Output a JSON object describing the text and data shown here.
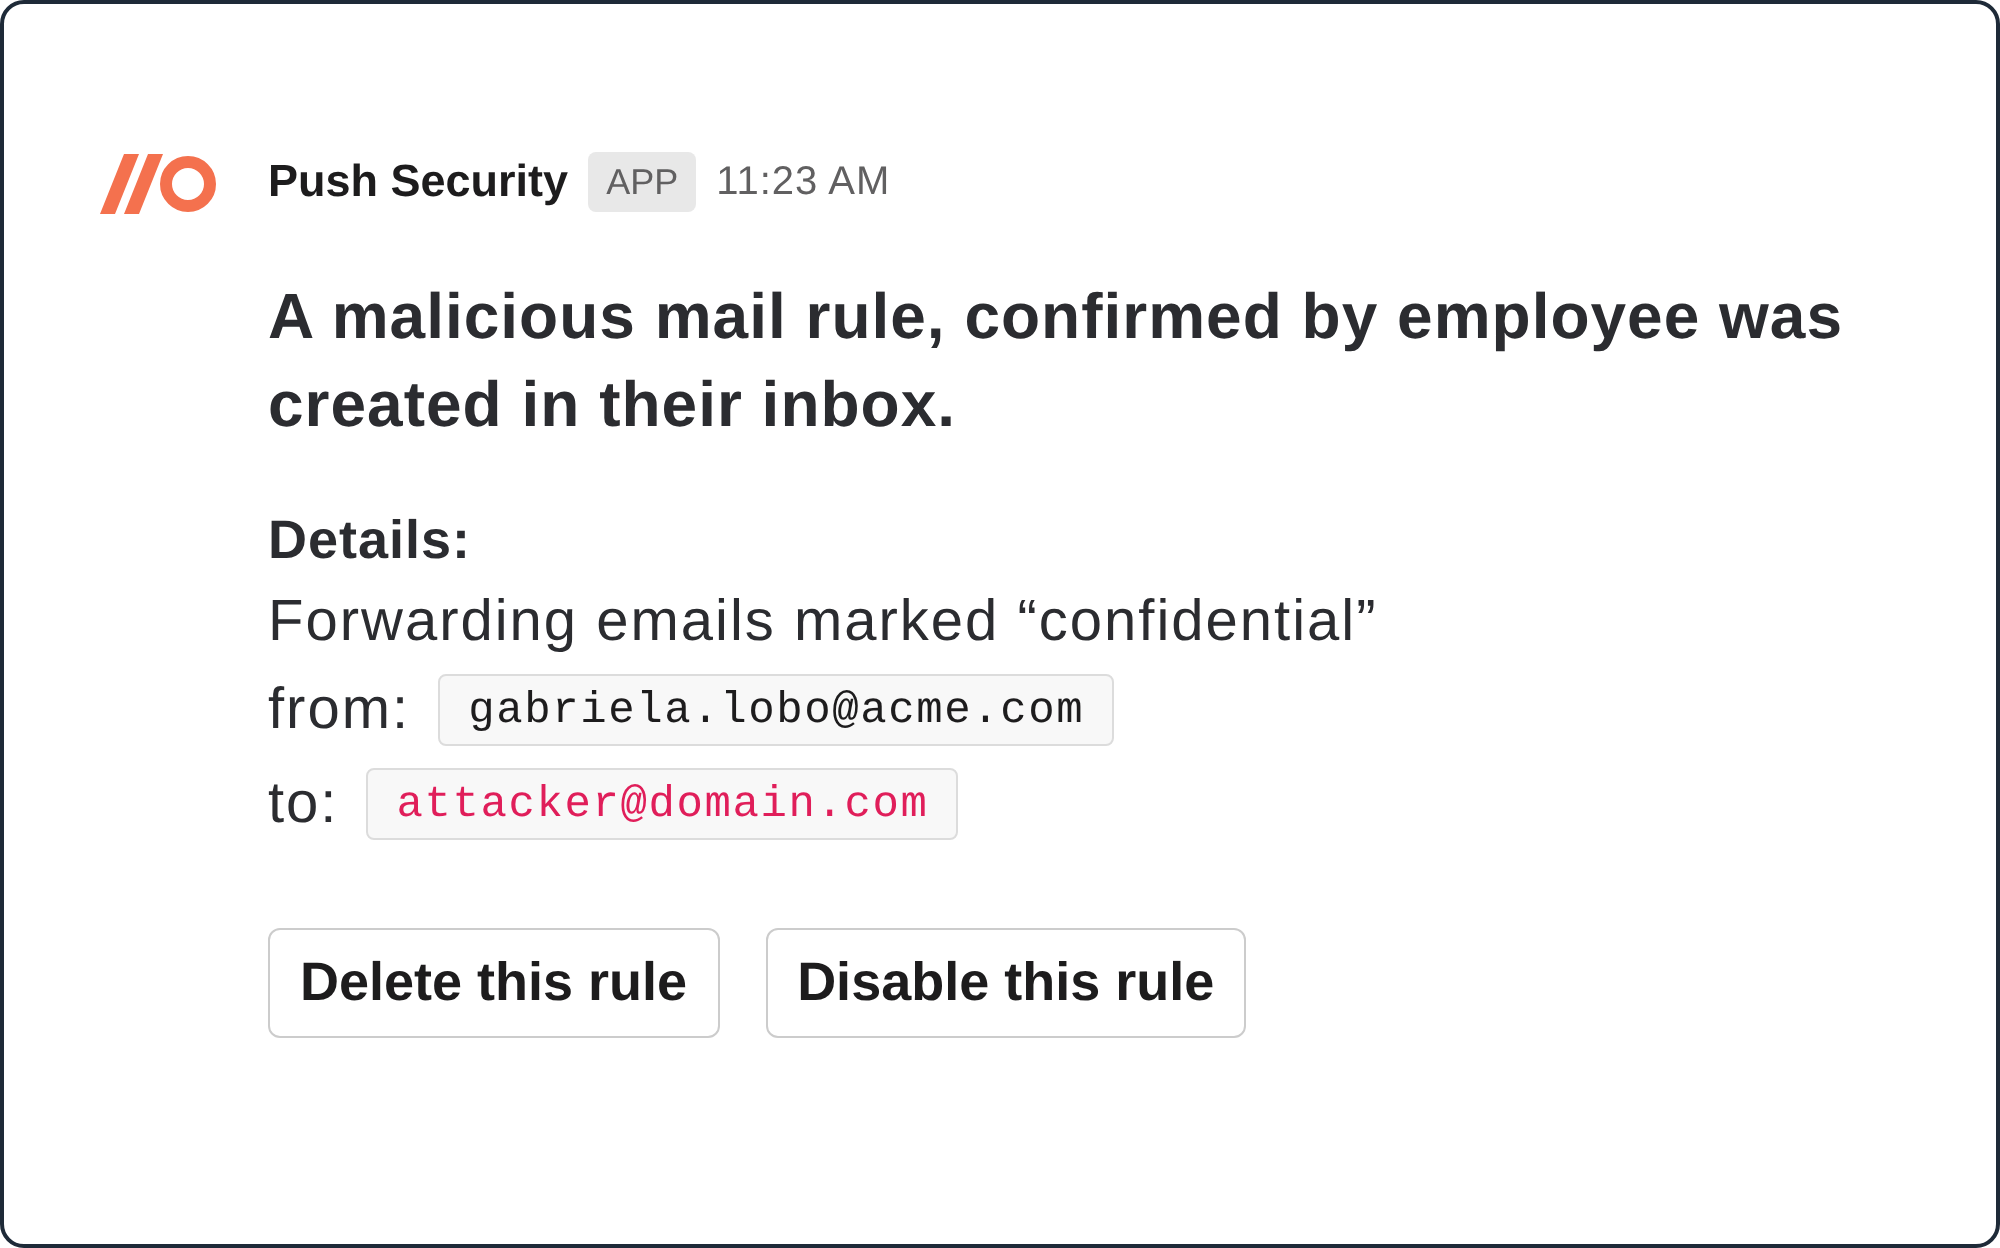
{
  "message": {
    "sender": "Push Security",
    "badge": "APP",
    "time": "11:23 AM",
    "headline": "A malicious mail rule, confirmed by employee was created in their inbox.",
    "details_label": "Details:",
    "description": "Forwarding emails marked “confidential”",
    "fields": [
      {
        "label": "from:",
        "value": "gabriela.lobo@acme.com",
        "color": "#1d1c1d"
      },
      {
        "label": "to:",
        "value": "attacker@domain.com",
        "color": "#e01e5a"
      }
    ],
    "buttons": [
      "Delete this rule",
      "Disable this rule"
    ]
  }
}
